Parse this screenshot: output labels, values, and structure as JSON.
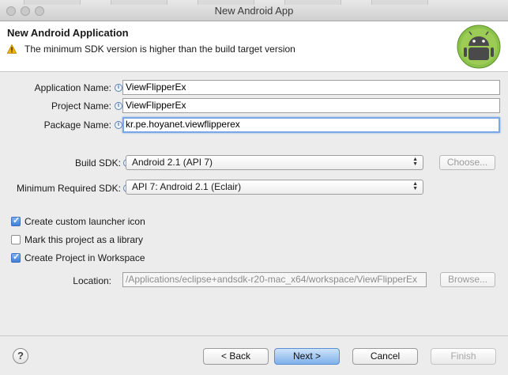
{
  "window": {
    "title": "New Android App"
  },
  "header": {
    "title": "New Android Application",
    "message": "The minimum SDK version is higher than the build target version"
  },
  "form": {
    "app_name_label": "Application Name:",
    "app_name_value": "ViewFlipperEx",
    "project_name_label": "Project Name:",
    "project_name_value": "ViewFlipperEx",
    "package_name_label": "Package Name:",
    "package_name_value": "kr.pe.hoyanet.viewflipperex",
    "build_sdk_label": "Build SDK:",
    "build_sdk_value": "Android 2.1 (API 7)",
    "choose_label": "Choose...",
    "min_sdk_label": "Minimum Required SDK:",
    "min_sdk_value": "API 7: Android 2.1 (Eclair)"
  },
  "options": {
    "custom_launcher_label": "Create custom launcher icon",
    "custom_launcher_checked": true,
    "library_label": "Mark this project as a library",
    "library_checked": false,
    "workspace_label": "Create Project in Workspace",
    "workspace_checked": true
  },
  "location": {
    "label": "Location:",
    "value": "/Applications/eclipse+andsdk-r20-mac_x64/workspace/ViewFlipperEx",
    "browse_label": "Browse..."
  },
  "buttons": {
    "help": "?",
    "back": "< Back",
    "next": "Next >",
    "cancel": "Cancel",
    "finish": "Finish"
  },
  "colors": {
    "accent": "#7fb0ea",
    "android_green": "#8bc34a",
    "warning": "#f0b400"
  }
}
